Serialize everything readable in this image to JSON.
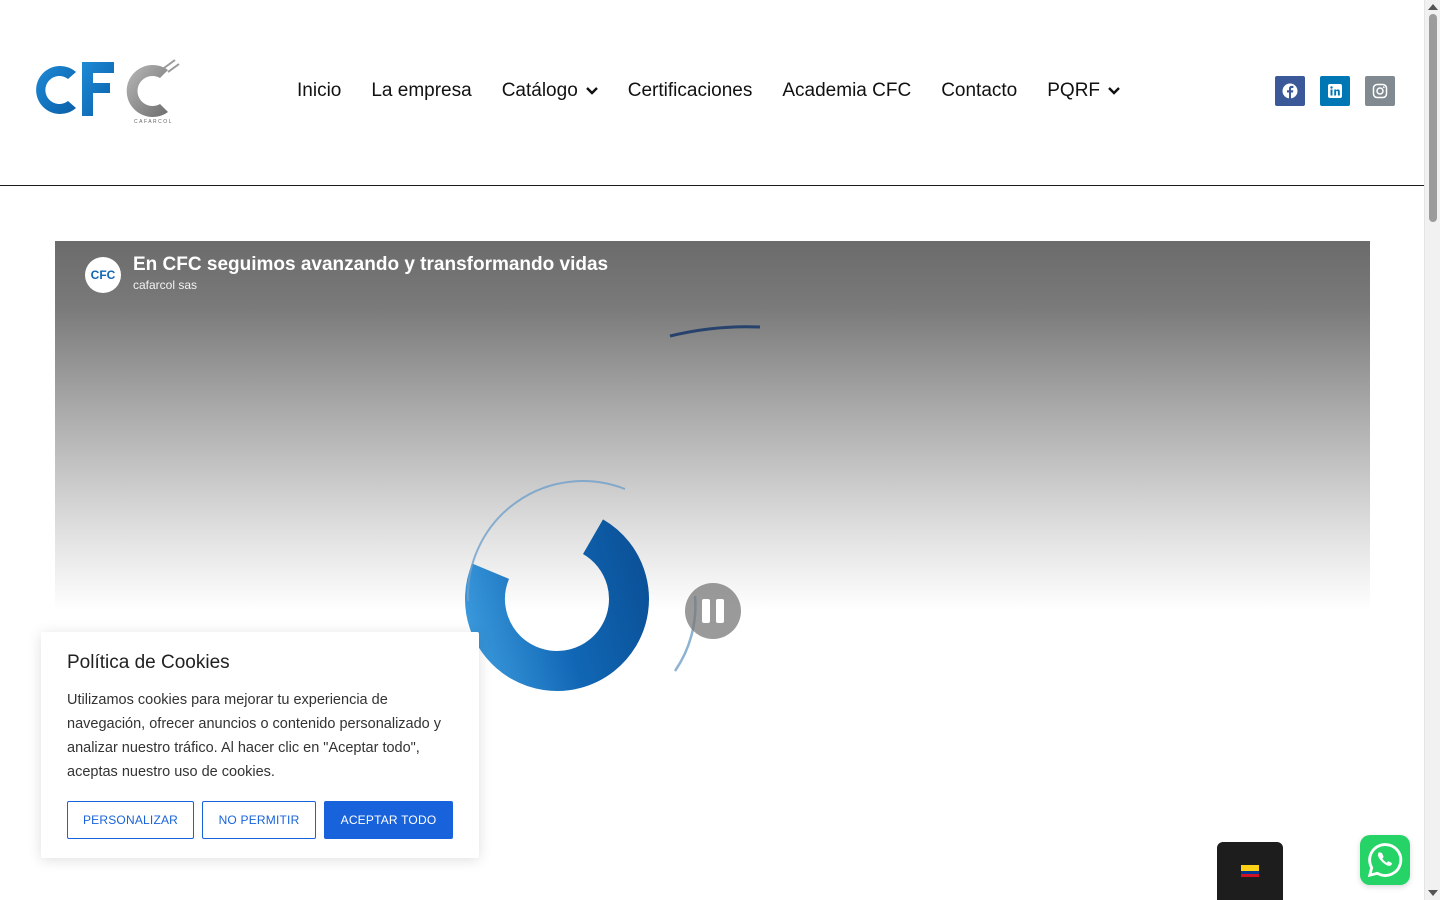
{
  "header": {
    "logo_text": "CFC",
    "logo_subtext": "CAFARCOL",
    "nav": [
      {
        "label": "Inicio"
      },
      {
        "label": "La empresa"
      },
      {
        "label": "Catálogo"
      },
      {
        "label": "Certificaciones"
      },
      {
        "label": "Academia CFC"
      },
      {
        "label": "Contacto"
      },
      {
        "label": "PQRF"
      }
    ],
    "social": [
      {
        "icon": "facebook-icon",
        "color": "#3b5998"
      },
      {
        "icon": "linkedin-icon",
        "color": "#0077b5"
      },
      {
        "icon": "instagram-icon",
        "color": "#818a91"
      }
    ]
  },
  "video": {
    "title": "En CFC seguimos avanzando y transformando vidas",
    "channel": "cafarcol sas",
    "state": "playing",
    "control_icon": "pause-icon"
  },
  "cookie": {
    "title": "Política de Cookies",
    "text": "Utilizamos cookies para mejorar tu experiencia de navegación, ofrecer anuncios o contenido personalizado y analizar nuestro tráfico. Al hacer clic en \"Aceptar todo\", aceptas nuestro uso de cookies.",
    "btn_customize": "PERSONALIZAR",
    "btn_reject": "NO PERMITIR",
    "btn_accept": "ACEPTAR TODO",
    "accent": "#1863dc"
  },
  "lang_switcher": {
    "icon": "colombia-flag-icon"
  },
  "whatsapp": {
    "icon": "whatsapp-icon",
    "color": "#25d366"
  }
}
